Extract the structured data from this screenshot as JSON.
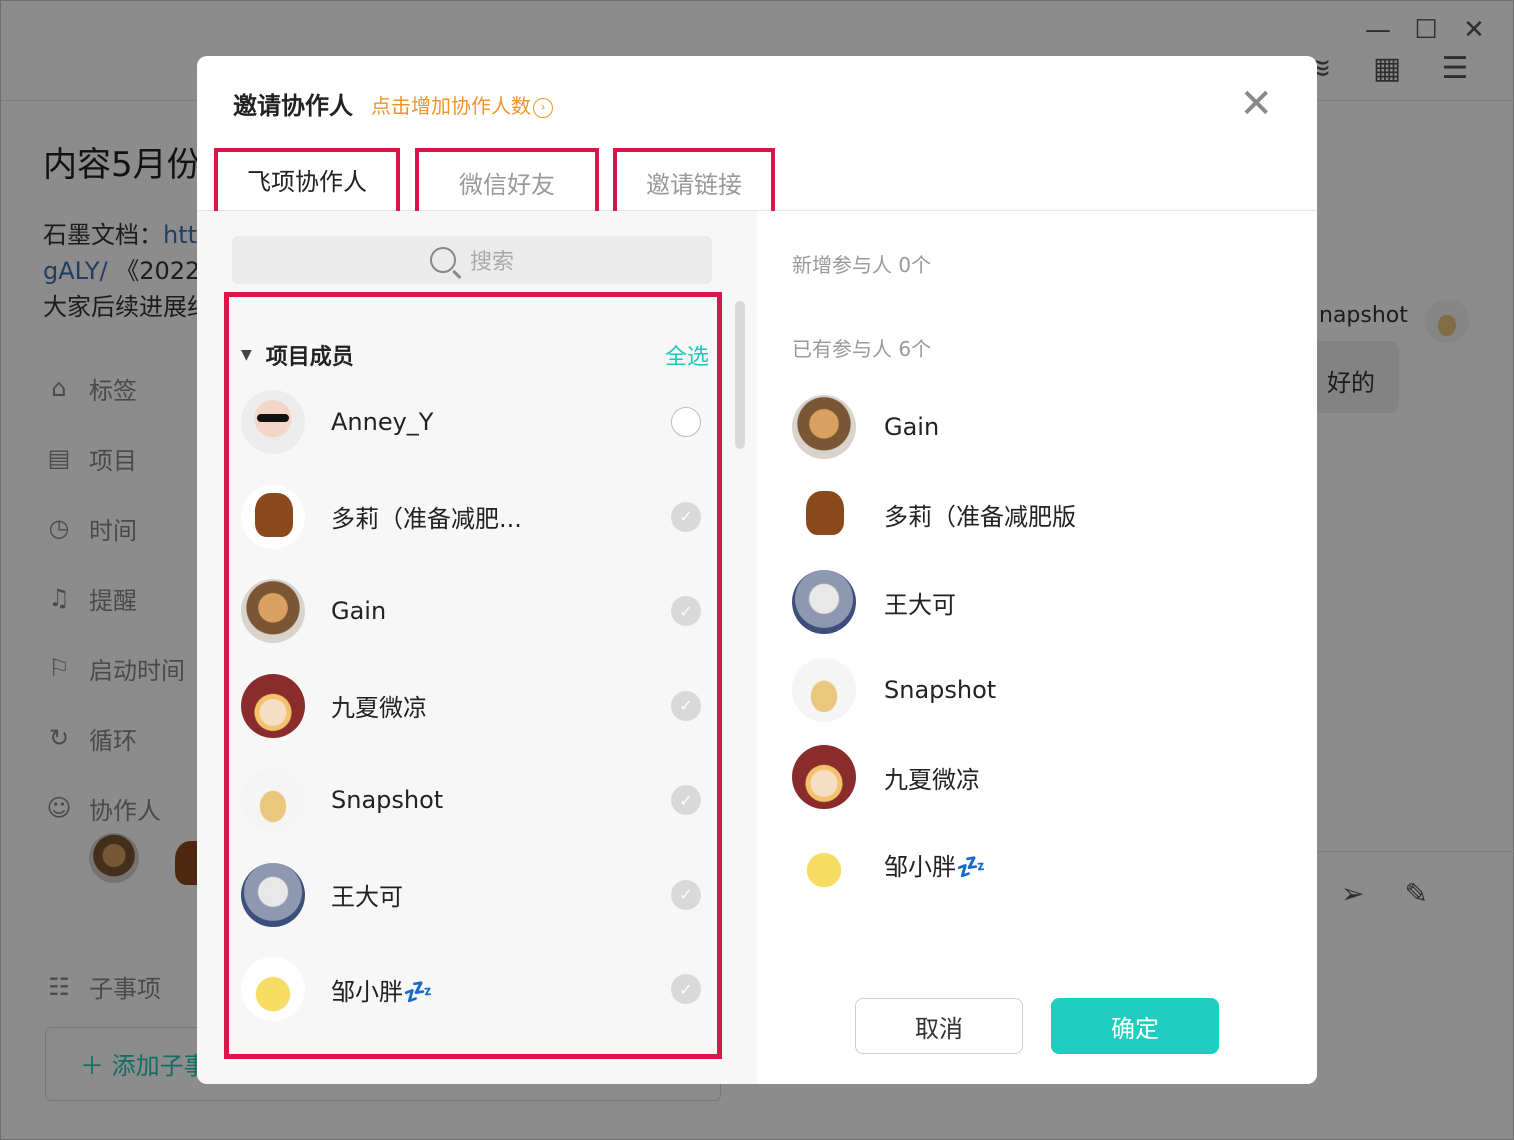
{
  "background": {
    "task_title": "内容5月份",
    "doc_line1_prefix": "石墨文档：",
    "doc_line1_link": "htt",
    "doc_line2_link": "gALY/",
    "doc_line2_text": " 《2022",
    "doc_line3_text": "大家后续进展约",
    "fields": [
      {
        "icon": "tag-icon",
        "glyph": "⌂",
        "label": "标签"
      },
      {
        "icon": "project-icon",
        "glyph": "▤",
        "label": "项目"
      },
      {
        "icon": "clock-icon",
        "glyph": "◷",
        "label": "时间"
      },
      {
        "icon": "bell-icon",
        "glyph": "♫",
        "label": "提醒"
      },
      {
        "icon": "flag-icon",
        "glyph": "⚐",
        "label": "启动时间"
      },
      {
        "icon": "repeat-icon",
        "glyph": "↻",
        "label": "循环"
      },
      {
        "icon": "users-icon",
        "glyph": "☺",
        "label": "协作人"
      }
    ],
    "sub_items_label": "子事项",
    "add_sub_label": "＋ 添加子事",
    "chat_name": "napshot",
    "chat_message": "好的"
  },
  "dialog": {
    "title": "邀请协作人",
    "subtitle": "点击增加协作人数",
    "close_glyph": "✕",
    "tabs": [
      "飞项协作人",
      "微信好友",
      "邀请链接"
    ],
    "search_placeholder": "搜索",
    "group": {
      "name": "项目成员",
      "select_all": "全选",
      "members": [
        {
          "name": "Anney_Y",
          "checked": false,
          "avatar": "a-anney"
        },
        {
          "name": "多莉（准备减肥...",
          "checked": true,
          "avatar": "a-dog"
        },
        {
          "name": "Gain",
          "checked": true,
          "avatar": "a-gain"
        },
        {
          "name": "九夏微凉",
          "checked": true,
          "avatar": "a-jx"
        },
        {
          "name": "Snapshot",
          "checked": true,
          "avatar": "a-snap"
        },
        {
          "name": "王大可",
          "checked": true,
          "avatar": "a-wang"
        },
        {
          "name": "邹小胖💤",
          "checked": true,
          "avatar": "a-zou"
        }
      ]
    },
    "new_participants_label": "新增参与人 0个",
    "existing_participants_label": "已有参与人 6个",
    "participants": [
      {
        "name": "Gain",
        "avatar": "a-gain"
      },
      {
        "name": "多莉（准备减肥版",
        "avatar": "a-dog"
      },
      {
        "name": "王大可",
        "avatar": "a-wang"
      },
      {
        "name": "Snapshot",
        "avatar": "a-snap"
      },
      {
        "name": "九夏微凉",
        "avatar": "a-jx"
      },
      {
        "name": "邹小胖💤",
        "avatar": "a-zou"
      }
    ],
    "cancel_label": "取消",
    "confirm_label": "确定"
  },
  "colors": {
    "accent": "#1ecfbf",
    "highlight_box": "#d6174a",
    "subtitle": "#f0952a"
  }
}
